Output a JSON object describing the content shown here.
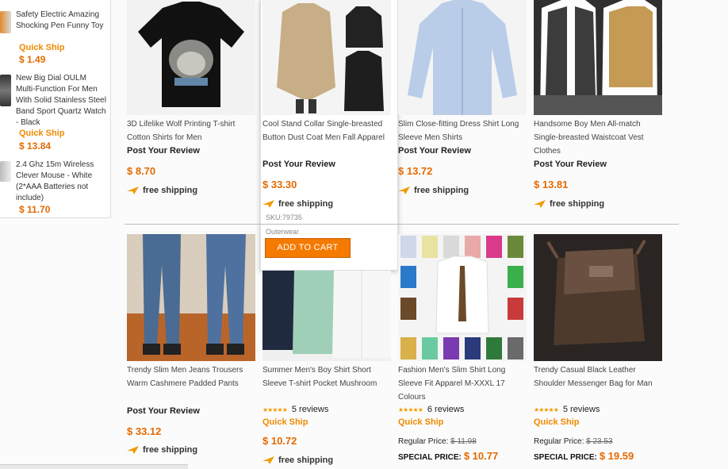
{
  "sidebar": {
    "items": [
      {
        "title": "Safety Electric Amazing Shocking Pen Funny Toy",
        "quick_ship": "Quick Ship",
        "price": "$ 1.49"
      },
      {
        "title": "New Big Dial OULM Multi-Function For Men With Solid Stainless Steel Band Sport Quartz Watch - Black",
        "quick_ship": "Quick Ship",
        "price": "$ 13.84"
      },
      {
        "title": "2.4 Ghz 15m Wireless Clever Mouse - White (2*AAA Batteries not include)",
        "price": "$ 11.70"
      }
    ]
  },
  "products": [
    {
      "title": "3D Lifelike Wolf Printing T-shirt Cotton Shirts for Men",
      "review": "Post Your Review",
      "price": "$ 8.70",
      "shipping": "free shipping"
    },
    {
      "title": "Cool Stand Collar Single-breasted Button Dust Coat Men Fall Apparel",
      "review": "Post Your Review",
      "price": "$ 33.30",
      "shipping": "free shipping",
      "sku": "SKU:79735",
      "category": "Outerwear",
      "cart": "ADD TO CART"
    },
    {
      "title": "Slim Close-fitting Dress Shirt Long Sleeve Men Shirts",
      "review": "Post Your Review",
      "price": "$ 13.72",
      "shipping": "free shipping"
    },
    {
      "title": "Handsome Boy Men All-match Single-breasted Waistcoat Vest Clothes",
      "review": "Post Your Review",
      "price": "$ 13.81",
      "shipping": "free shipping"
    },
    {
      "title": "Trendy Slim Men Jeans Trousers Warm Cashmere Padded Pants",
      "review": "Post Your Review",
      "price": "$ 33.12",
      "shipping": "free shipping"
    },
    {
      "title": "Summer Men's Boy Shirt Short Sleeve T-shirt Pocket Mushroom",
      "reviews": "5 reviews",
      "quick_ship": "Quick Ship",
      "price": "$ 10.72",
      "shipping": "free shipping"
    },
    {
      "title": "Fashion Men's Slim Shirt Long Sleeve Fit Apparel M-XXXL 17 Colours",
      "reviews": "6 reviews",
      "quick_ship": "Quick Ship",
      "regular_label": "Regular Price:",
      "regular_price": "$ 11.98",
      "special_label": "SPECIAL PRICE:",
      "special_price": "$ 10.77"
    },
    {
      "title": "Trendy Casual Black Leather Shoulder Messenger Bag for Man",
      "reviews": "5 reviews",
      "quick_ship": "Quick Ship",
      "regular_label": "Regular Price:",
      "regular_price": "$ 23.53",
      "special_label": "SPECIAL PRICE:",
      "special_price": "$ 19.59"
    }
  ],
  "stars": "★★★★★",
  "colors": {
    "price": "#e46a00",
    "quick_ship": "#f08a00",
    "cart_button": "#f47a00"
  }
}
